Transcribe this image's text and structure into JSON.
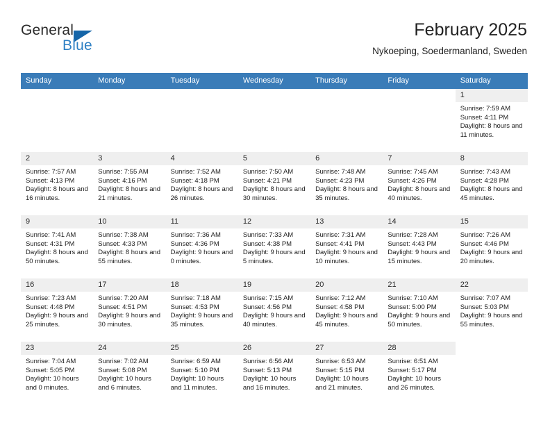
{
  "brand": {
    "name_top": "General",
    "name_bottom": "Blue",
    "triangle_color": "#1565a8",
    "text_color_top": "#2b2b2b",
    "text_color_bottom": "#2f80c4"
  },
  "header": {
    "title": "February 2025",
    "subtitle": "Nykoeping, Soedermanland, Sweden"
  },
  "theme": {
    "header_blue": "#3a7cb8",
    "daynum_band": "#efefef",
    "grid_line": "#d8d8d8"
  },
  "weekdays": [
    "Sunday",
    "Monday",
    "Tuesday",
    "Wednesday",
    "Thursday",
    "Friday",
    "Saturday"
  ],
  "labels": {
    "sunrise": "Sunrise:",
    "sunset": "Sunset:",
    "daylight": "Daylight:"
  },
  "weeks": [
    [
      {
        "day": "",
        "blank": true
      },
      {
        "day": "",
        "blank": true
      },
      {
        "day": "",
        "blank": true
      },
      {
        "day": "",
        "blank": true
      },
      {
        "day": "",
        "blank": true
      },
      {
        "day": "",
        "blank": true
      },
      {
        "day": "1",
        "sunrise": "Sunrise: 7:59 AM",
        "sunset": "Sunset: 4:11 PM",
        "daylight": "Daylight: 8 hours and 11 minutes."
      }
    ],
    [
      {
        "day": "2",
        "sunrise": "Sunrise: 7:57 AM",
        "sunset": "Sunset: 4:13 PM",
        "daylight": "Daylight: 8 hours and 16 minutes."
      },
      {
        "day": "3",
        "sunrise": "Sunrise: 7:55 AM",
        "sunset": "Sunset: 4:16 PM",
        "daylight": "Daylight: 8 hours and 21 minutes."
      },
      {
        "day": "4",
        "sunrise": "Sunrise: 7:52 AM",
        "sunset": "Sunset: 4:18 PM",
        "daylight": "Daylight: 8 hours and 26 minutes."
      },
      {
        "day": "5",
        "sunrise": "Sunrise: 7:50 AM",
        "sunset": "Sunset: 4:21 PM",
        "daylight": "Daylight: 8 hours and 30 minutes."
      },
      {
        "day": "6",
        "sunrise": "Sunrise: 7:48 AM",
        "sunset": "Sunset: 4:23 PM",
        "daylight": "Daylight: 8 hours and 35 minutes."
      },
      {
        "day": "7",
        "sunrise": "Sunrise: 7:45 AM",
        "sunset": "Sunset: 4:26 PM",
        "daylight": "Daylight: 8 hours and 40 minutes."
      },
      {
        "day": "8",
        "sunrise": "Sunrise: 7:43 AM",
        "sunset": "Sunset: 4:28 PM",
        "daylight": "Daylight: 8 hours and 45 minutes."
      }
    ],
    [
      {
        "day": "9",
        "sunrise": "Sunrise: 7:41 AM",
        "sunset": "Sunset: 4:31 PM",
        "daylight": "Daylight: 8 hours and 50 minutes."
      },
      {
        "day": "10",
        "sunrise": "Sunrise: 7:38 AM",
        "sunset": "Sunset: 4:33 PM",
        "daylight": "Daylight: 8 hours and 55 minutes."
      },
      {
        "day": "11",
        "sunrise": "Sunrise: 7:36 AM",
        "sunset": "Sunset: 4:36 PM",
        "daylight": "Daylight: 9 hours and 0 minutes."
      },
      {
        "day": "12",
        "sunrise": "Sunrise: 7:33 AM",
        "sunset": "Sunset: 4:38 PM",
        "daylight": "Daylight: 9 hours and 5 minutes."
      },
      {
        "day": "13",
        "sunrise": "Sunrise: 7:31 AM",
        "sunset": "Sunset: 4:41 PM",
        "daylight": "Daylight: 9 hours and 10 minutes."
      },
      {
        "day": "14",
        "sunrise": "Sunrise: 7:28 AM",
        "sunset": "Sunset: 4:43 PM",
        "daylight": "Daylight: 9 hours and 15 minutes."
      },
      {
        "day": "15",
        "sunrise": "Sunrise: 7:26 AM",
        "sunset": "Sunset: 4:46 PM",
        "daylight": "Daylight: 9 hours and 20 minutes."
      }
    ],
    [
      {
        "day": "16",
        "sunrise": "Sunrise: 7:23 AM",
        "sunset": "Sunset: 4:48 PM",
        "daylight": "Daylight: 9 hours and 25 minutes."
      },
      {
        "day": "17",
        "sunrise": "Sunrise: 7:20 AM",
        "sunset": "Sunset: 4:51 PM",
        "daylight": "Daylight: 9 hours and 30 minutes."
      },
      {
        "day": "18",
        "sunrise": "Sunrise: 7:18 AM",
        "sunset": "Sunset: 4:53 PM",
        "daylight": "Daylight: 9 hours and 35 minutes."
      },
      {
        "day": "19",
        "sunrise": "Sunrise: 7:15 AM",
        "sunset": "Sunset: 4:56 PM",
        "daylight": "Daylight: 9 hours and 40 minutes."
      },
      {
        "day": "20",
        "sunrise": "Sunrise: 7:12 AM",
        "sunset": "Sunset: 4:58 PM",
        "daylight": "Daylight: 9 hours and 45 minutes."
      },
      {
        "day": "21",
        "sunrise": "Sunrise: 7:10 AM",
        "sunset": "Sunset: 5:00 PM",
        "daylight": "Daylight: 9 hours and 50 minutes."
      },
      {
        "day": "22",
        "sunrise": "Sunrise: 7:07 AM",
        "sunset": "Sunset: 5:03 PM",
        "daylight": "Daylight: 9 hours and 55 minutes."
      }
    ],
    [
      {
        "day": "23",
        "sunrise": "Sunrise: 7:04 AM",
        "sunset": "Sunset: 5:05 PM",
        "daylight": "Daylight: 10 hours and 0 minutes."
      },
      {
        "day": "24",
        "sunrise": "Sunrise: 7:02 AM",
        "sunset": "Sunset: 5:08 PM",
        "daylight": "Daylight: 10 hours and 6 minutes."
      },
      {
        "day": "25",
        "sunrise": "Sunrise: 6:59 AM",
        "sunset": "Sunset: 5:10 PM",
        "daylight": "Daylight: 10 hours and 11 minutes."
      },
      {
        "day": "26",
        "sunrise": "Sunrise: 6:56 AM",
        "sunset": "Sunset: 5:13 PM",
        "daylight": "Daylight: 10 hours and 16 minutes."
      },
      {
        "day": "27",
        "sunrise": "Sunrise: 6:53 AM",
        "sunset": "Sunset: 5:15 PM",
        "daylight": "Daylight: 10 hours and 21 minutes."
      },
      {
        "day": "28",
        "sunrise": "Sunrise: 6:51 AM",
        "sunset": "Sunset: 5:17 PM",
        "daylight": "Daylight: 10 hours and 26 minutes."
      },
      {
        "day": "",
        "blank": true
      }
    ]
  ]
}
